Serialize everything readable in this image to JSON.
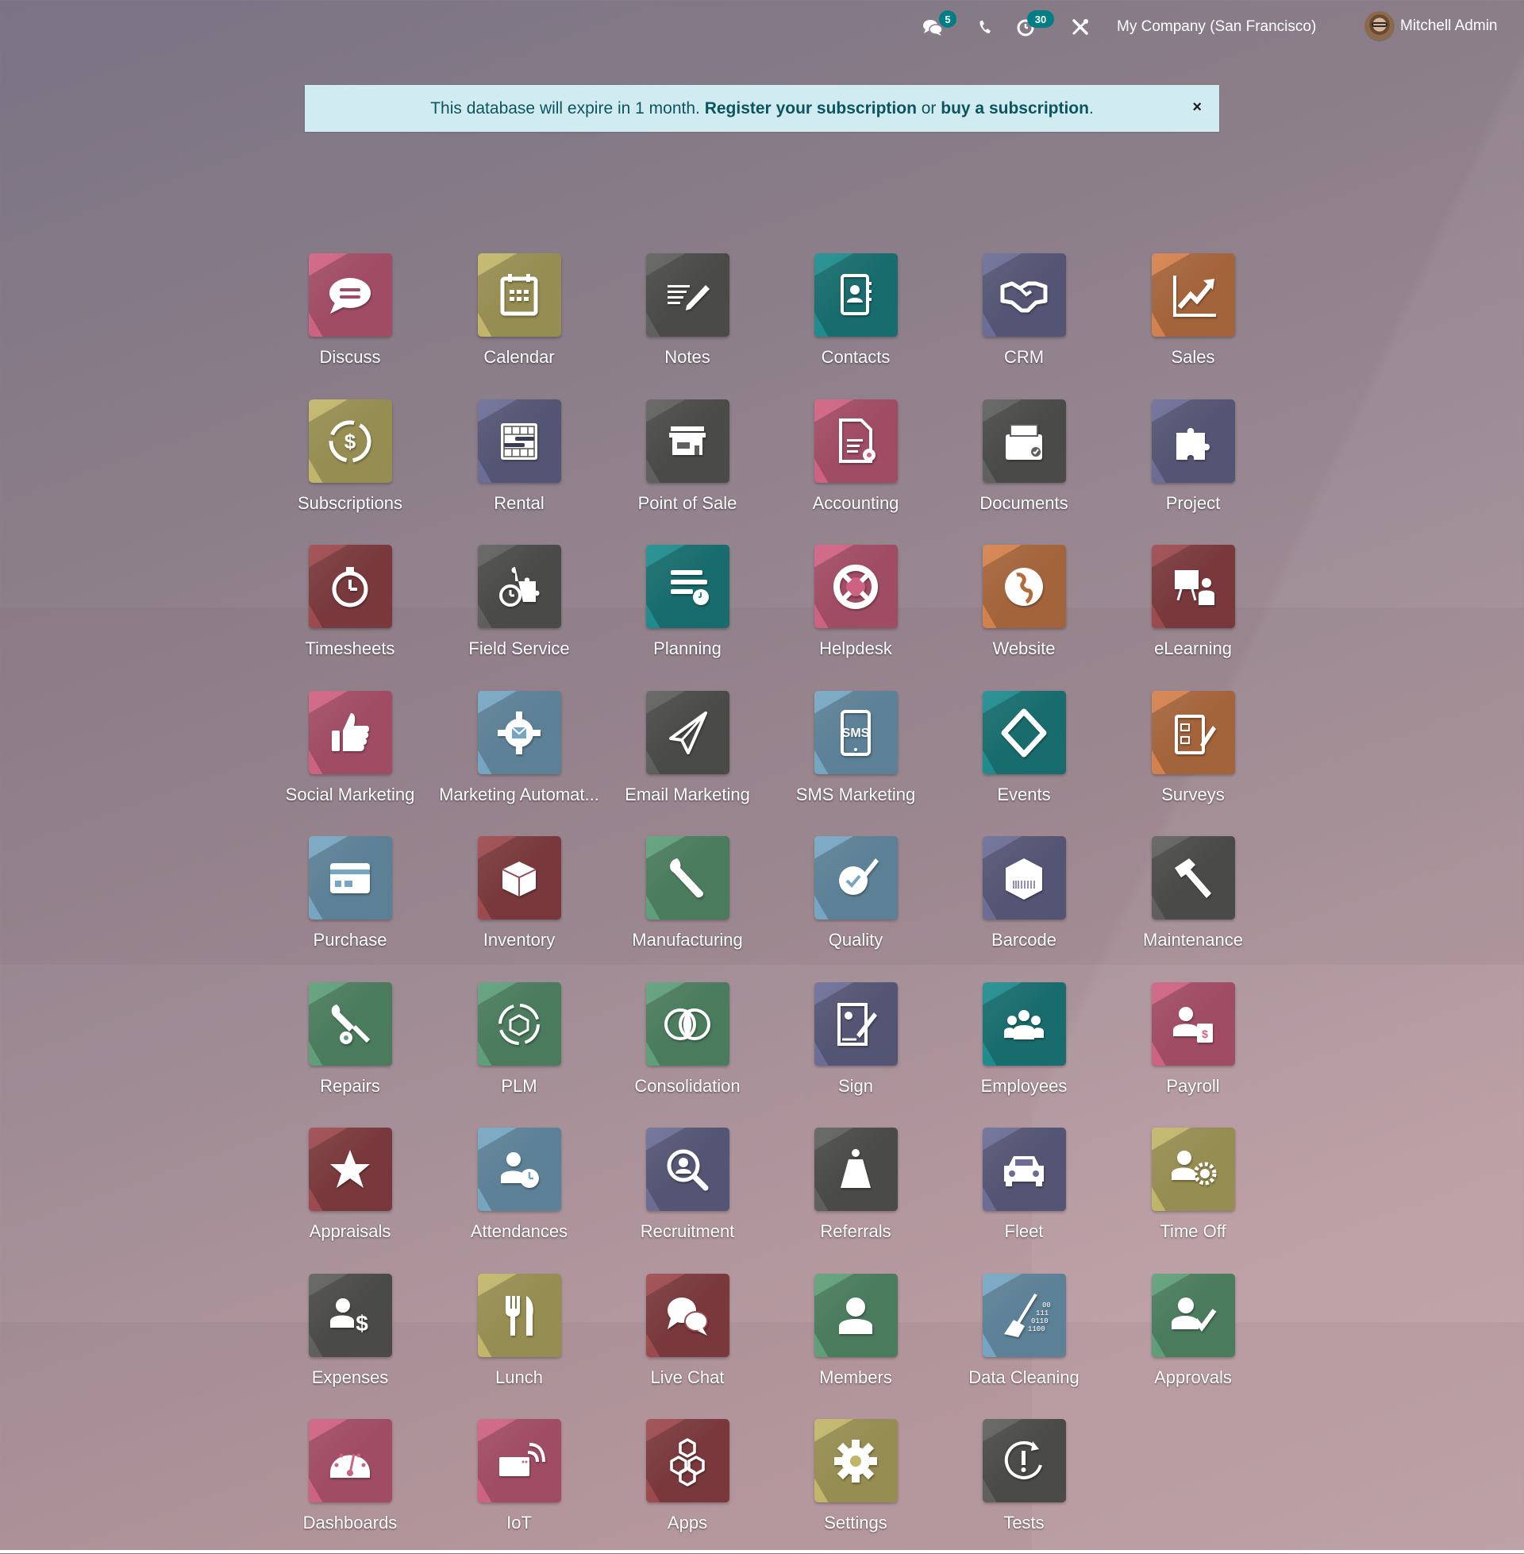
{
  "topbar": {
    "messages_badge": "5",
    "activities_badge": "30",
    "company": "My Company (San Francisco)",
    "user_name": "Mitchell Admin",
    "icons": [
      "chat-icon",
      "phone-icon",
      "clock-icon",
      "tools-icon"
    ]
  },
  "banner": {
    "text_before": "This database will expire in 1 month. ",
    "register_link": "Register your subscription",
    "text_middle": " or ",
    "buy_link": "buy a subscription",
    "text_after": ".",
    "close_label": "×"
  },
  "colors": {
    "badge": "#017e84",
    "banner_bg": "#d1ecf1",
    "banner_text": "#0c5460"
  },
  "apps": [
    {
      "label": "Discuss",
      "icon": "chat-bubble",
      "color": "#cd6281"
    },
    {
      "label": "Calendar",
      "icon": "calendar",
      "color": "#c1b56a"
    },
    {
      "label": "Notes",
      "icon": "notes",
      "color": "#5f605e"
    },
    {
      "label": "Contacts",
      "icon": "contacts",
      "color": "#1f8b8c"
    },
    {
      "label": "CRM",
      "icon": "handshake",
      "color": "#6c6d95"
    },
    {
      "label": "Sales",
      "icon": "chart-up",
      "color": "#d3814c"
    },
    {
      "label": "Subscriptions",
      "icon": "recurring-dollar",
      "color": "#c1b56a"
    },
    {
      "label": "Rental",
      "icon": "rental-grid",
      "color": "#6c6d95"
    },
    {
      "label": "Point of Sale",
      "icon": "shop",
      "color": "#5f605e"
    },
    {
      "label": "Accounting",
      "icon": "document-gear",
      "color": "#cd6281"
    },
    {
      "label": "Documents",
      "icon": "file-box",
      "color": "#5f605e"
    },
    {
      "label": "Project",
      "icon": "puzzle",
      "color": "#6c6d95"
    },
    {
      "label": "Timesheets",
      "icon": "stopwatch",
      "color": "#9c4a4e"
    },
    {
      "label": "Field Service",
      "icon": "puzzle-stopwatch",
      "color": "#5f605e"
    },
    {
      "label": "Planning",
      "icon": "planning",
      "color": "#1f8b8c"
    },
    {
      "label": "Helpdesk",
      "icon": "lifebuoy",
      "color": "#cd6281"
    },
    {
      "label": "Website",
      "icon": "globe",
      "color": "#d3814c"
    },
    {
      "label": "eLearning",
      "icon": "presentation",
      "color": "#9c4a4e"
    },
    {
      "label": "Social Marketing",
      "icon": "thumbs-up",
      "color": "#cd6281"
    },
    {
      "label": "Marketing Automat...",
      "icon": "gear-envelope",
      "color": "#76a5c1"
    },
    {
      "label": "Email Marketing",
      "icon": "paper-plane",
      "color": "#5f605e"
    },
    {
      "label": "SMS Marketing",
      "icon": "sms-phone",
      "color": "#76a5c1"
    },
    {
      "label": "Events",
      "icon": "ticket",
      "color": "#1f8b8c"
    },
    {
      "label": "Surveys",
      "icon": "checklist",
      "color": "#d3814c"
    },
    {
      "label": "Purchase",
      "icon": "credit-card",
      "color": "#76a5c1"
    },
    {
      "label": "Inventory",
      "icon": "box",
      "color": "#9c4a4e"
    },
    {
      "label": "Manufacturing",
      "icon": "wrench",
      "color": "#5f9e78"
    },
    {
      "label": "Quality",
      "icon": "badge-check",
      "color": "#76a5c1"
    },
    {
      "label": "Barcode",
      "icon": "box-barcode",
      "color": "#6c6d95"
    },
    {
      "label": "Maintenance",
      "icon": "hammer",
      "color": "#5f605e"
    },
    {
      "label": "Repairs",
      "icon": "wrench-gear",
      "color": "#5f9e78"
    },
    {
      "label": "PLM",
      "icon": "cycle-box",
      "color": "#5f9e78"
    },
    {
      "label": "Consolidation",
      "icon": "overlap-circles",
      "color": "#5f9e78"
    },
    {
      "label": "Sign",
      "icon": "sign-doc",
      "color": "#6c6d95"
    },
    {
      "label": "Employees",
      "icon": "people",
      "color": "#1f8b8c"
    },
    {
      "label": "Payroll",
      "icon": "person-dollar",
      "color": "#cd6281"
    },
    {
      "label": "Appraisals",
      "icon": "star",
      "color": "#9c4a4e"
    },
    {
      "label": "Attendances",
      "icon": "person-clock",
      "color": "#76a5c1"
    },
    {
      "label": "Recruitment",
      "icon": "magnifier-person",
      "color": "#6c6d95"
    },
    {
      "label": "Referrals",
      "icon": "hero",
      "color": "#5f605e"
    },
    {
      "label": "Fleet",
      "icon": "car",
      "color": "#6c6d95"
    },
    {
      "label": "Time Off",
      "icon": "person-sun",
      "color": "#c1b56a"
    },
    {
      "label": "Expenses",
      "icon": "person-dollar-sign",
      "color": "#5f605e"
    },
    {
      "label": "Lunch",
      "icon": "fork-knife",
      "color": "#c1b56a"
    },
    {
      "label": "Live Chat",
      "icon": "chat-bubbles",
      "color": "#9c4a4e"
    },
    {
      "label": "Members",
      "icon": "person",
      "color": "#5f9e78"
    },
    {
      "label": "Data Cleaning",
      "icon": "broom-binary",
      "color": "#76a5c1"
    },
    {
      "label": "Approvals",
      "icon": "person-check",
      "color": "#5f9e78"
    },
    {
      "label": "Dashboards",
      "icon": "gauge",
      "color": "#cd6281"
    },
    {
      "label": "IoT",
      "icon": "iot-device",
      "color": "#cd6281"
    },
    {
      "label": "Apps",
      "icon": "cubes",
      "color": "#9c4a4e"
    },
    {
      "label": "Settings",
      "icon": "gear",
      "color": "#c1b56a"
    },
    {
      "label": "Tests",
      "icon": "rerun-alert",
      "color": "#5f605e"
    }
  ]
}
